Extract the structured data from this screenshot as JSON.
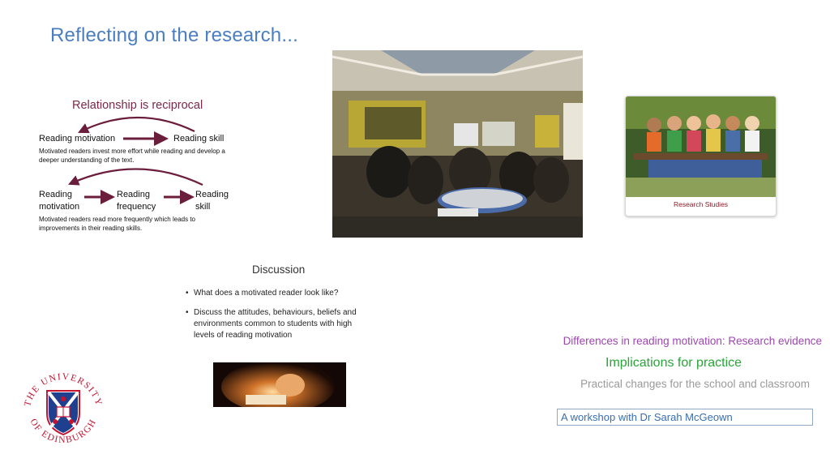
{
  "slide": {
    "title": "Reflecting on the research..."
  },
  "relationship": {
    "heading": "Relationship is reciprocal",
    "row1_left": "Reading motivation",
    "row1_right": "Reading skill",
    "row1_note": [
      "Motivated readers invest more effort while reading and develop a",
      "deeper understanding of the text."
    ],
    "row2_a": [
      "Reading",
      "motivation"
    ],
    "row2_b": [
      "Reading",
      "frequency"
    ],
    "row2_c": [
      "Reading",
      "skill"
    ],
    "row2_note": [
      "Motivated readers read more frequently which leads to",
      "improvements in their reading skills."
    ],
    "arrow_color": "#6b1d3c"
  },
  "photo": {
    "icon": "classroom-workshop-photo"
  },
  "research_card": {
    "caption": "Research Studies"
  },
  "discussion": {
    "heading": "Discussion",
    "bullet1": "What does a motivated reader look like?",
    "bullet2": [
      "Discuss the attitudes, behaviours, beliefs and",
      "environments common to students with high",
      "levels of reading motivation"
    ]
  },
  "links": {
    "research_evidence": "Differences in reading motivation: Research evidence",
    "implications": "Implications for practice",
    "practical_changes": "Practical changes for the school and classroom",
    "workshop": "A workshop with Dr Sarah McGeown"
  },
  "crest": {
    "text_top": "THE UNIVERSITY",
    "text_bottom": "OF EDINBURGH",
    "color": "#c4122f",
    "shield_blue": "#1f3f8f"
  },
  "colors": {
    "title": "#4a7ec2",
    "purple_link": "#a045b4",
    "green_link": "#27a637",
    "grey_link": "#9a9a9a"
  }
}
